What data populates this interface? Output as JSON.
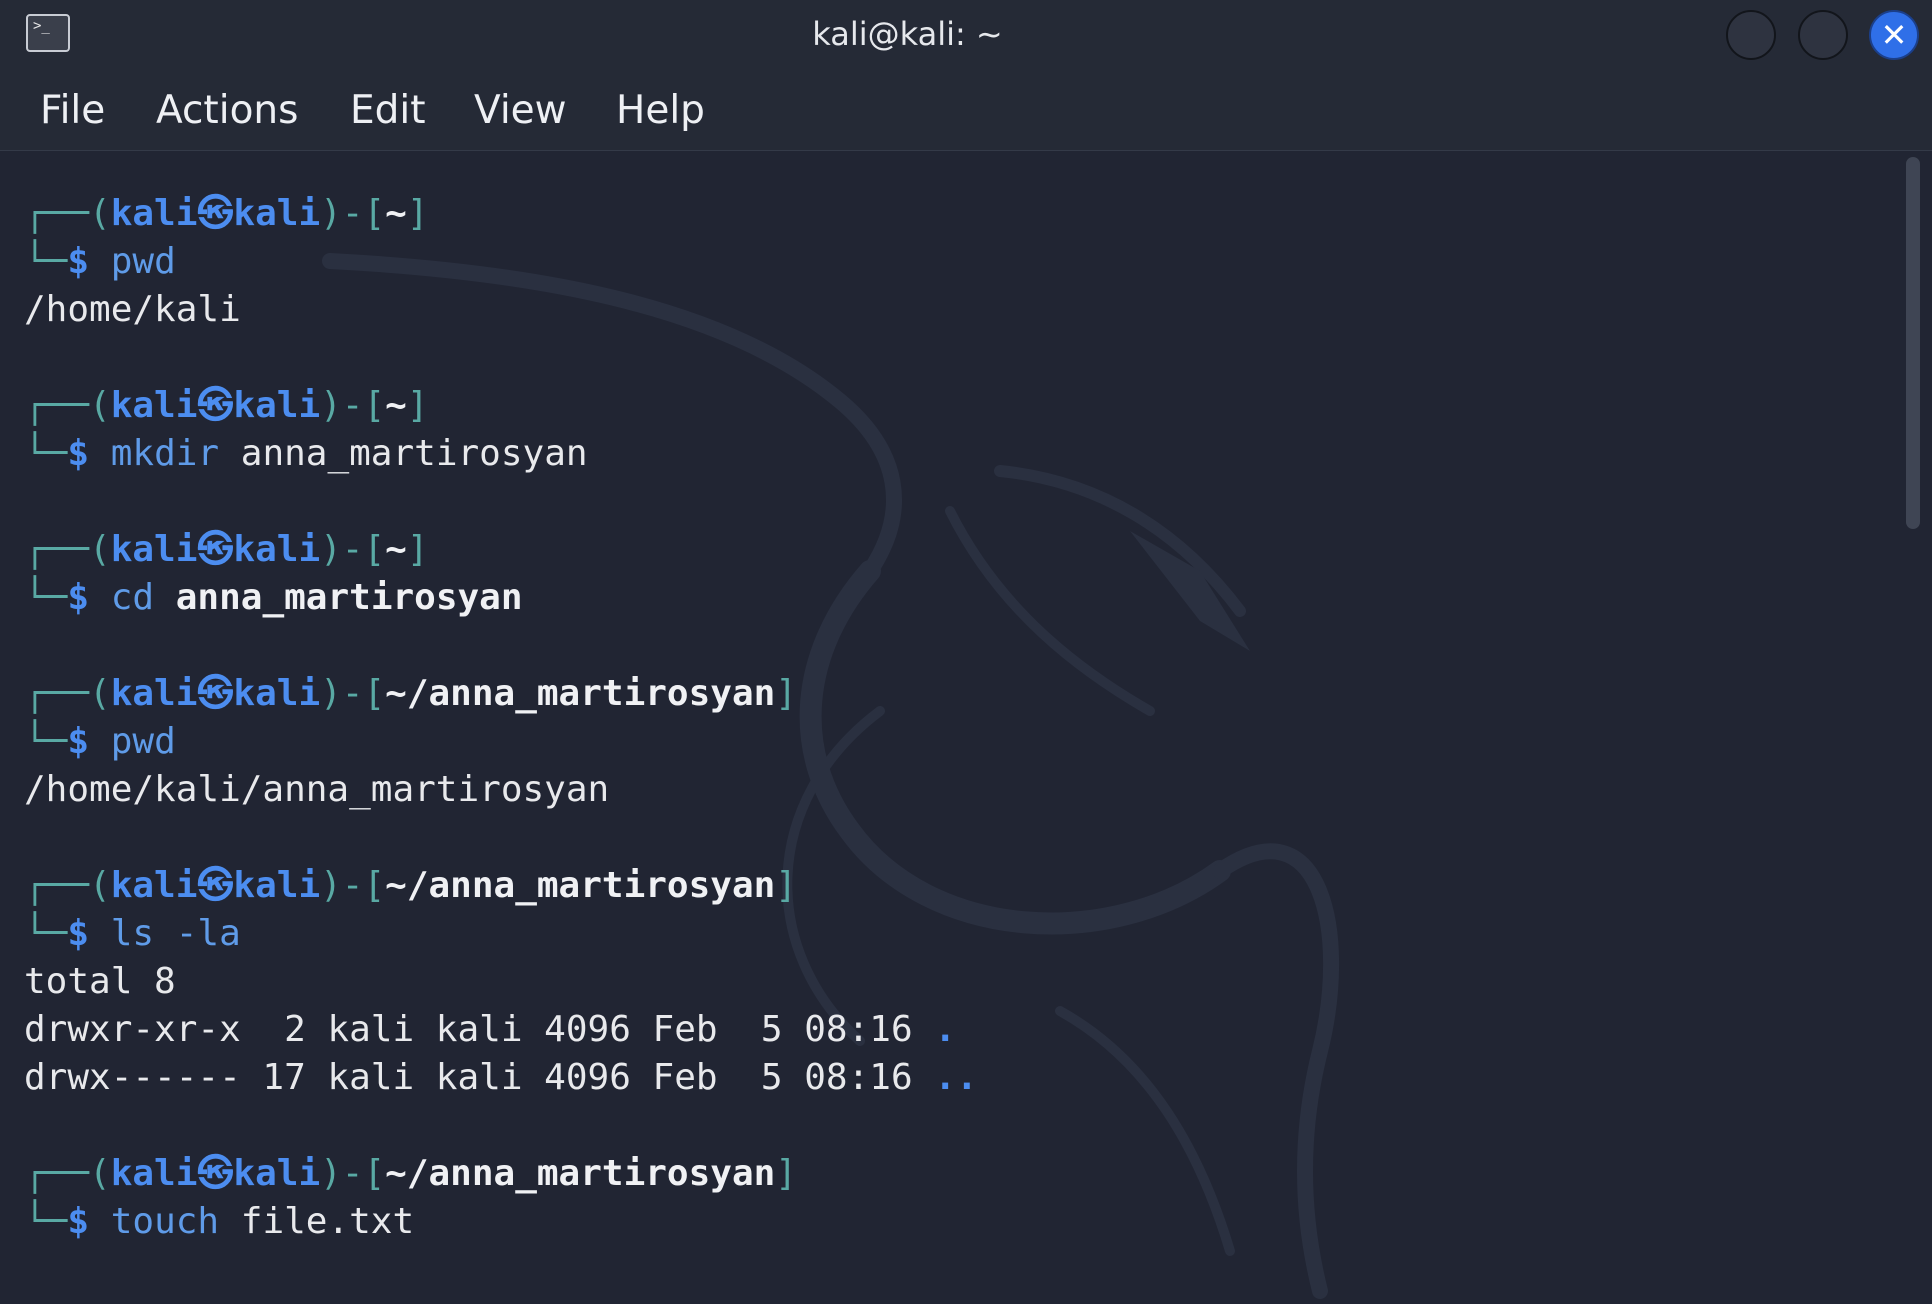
{
  "window": {
    "title": "kali@kali: ~",
    "terminal_icon_glyph": ">_",
    "close_glyph": "✕"
  },
  "menu": {
    "items": [
      "File",
      "Actions",
      "Edit",
      "View",
      "Help"
    ]
  },
  "terminal": {
    "user": "kali",
    "host": "kali",
    "blocks": [
      {
        "dir": "~",
        "command": "pwd",
        "args": "",
        "args_bold": false,
        "output": [
          "/home/kali"
        ]
      },
      {
        "dir": "~",
        "command": "mkdir",
        "args": "anna_martirosyan",
        "args_bold": false,
        "output": []
      },
      {
        "dir": "~",
        "command": "cd",
        "args": "anna_martirosyan",
        "args_bold": true,
        "output": []
      },
      {
        "dir": "~/anna_martirosyan",
        "command": "pwd",
        "args": "",
        "args_bold": false,
        "output": [
          "/home/kali/anna_martirosyan"
        ]
      },
      {
        "dir": "~/anna_martirosyan",
        "command": "ls",
        "args": "-la",
        "args_bold": false,
        "output": [
          "total 8",
          "drwxr-xr-x  2 kali kali 4096 Feb  5 08:16 .",
          "drwx------ 17 kali kali 4096 Feb  5 08:16 .."
        ]
      },
      {
        "dir": "~/anna_martirosyan",
        "command": "touch",
        "args": "file.txt",
        "args_bold": false,
        "output": []
      }
    ]
  },
  "colors": {
    "background": "#212533",
    "prompt_box": "#59a9a4",
    "user_host": "#4c8df0",
    "command": "#5f9be8",
    "text": "#e8e9ec",
    "close_button": "#2f6fe8"
  }
}
